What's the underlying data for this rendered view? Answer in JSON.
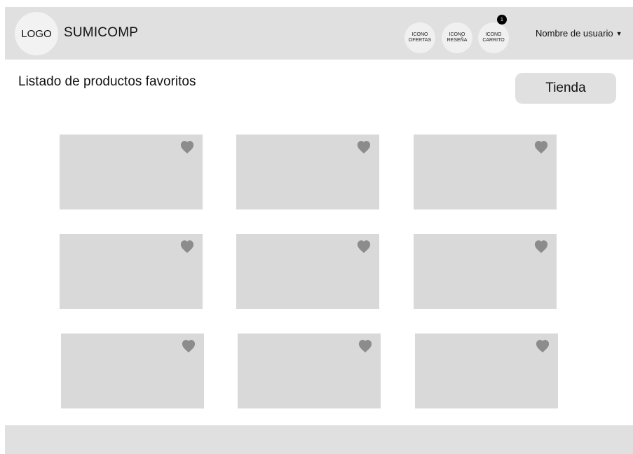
{
  "header": {
    "logo_label": "LOGO",
    "brand": "SUMICOMP",
    "icons": {
      "ofertas": "ICONO\nOFERTAS",
      "resena": "ICONO\nRESEÑA",
      "carrito": "ICONO\nCARRITO"
    },
    "cart_count": "1",
    "user_name": "Nombre de usuario",
    "user_caret": "▼"
  },
  "main": {
    "title": "Listado de productos favoritos",
    "store_button": "Tienda",
    "products": [
      {
        "icon": "heart-icon"
      },
      {
        "icon": "heart-icon"
      },
      {
        "icon": "heart-icon"
      },
      {
        "icon": "heart-icon"
      },
      {
        "icon": "heart-icon"
      },
      {
        "icon": "heart-icon"
      },
      {
        "icon": "heart-icon"
      },
      {
        "icon": "heart-icon"
      },
      {
        "icon": "heart-icon"
      }
    ]
  },
  "colors": {
    "header_bg": "#e0e0e0",
    "card_bg": "#d9d9d9",
    "heart": "#8c8c8c",
    "badge": "#000000"
  }
}
